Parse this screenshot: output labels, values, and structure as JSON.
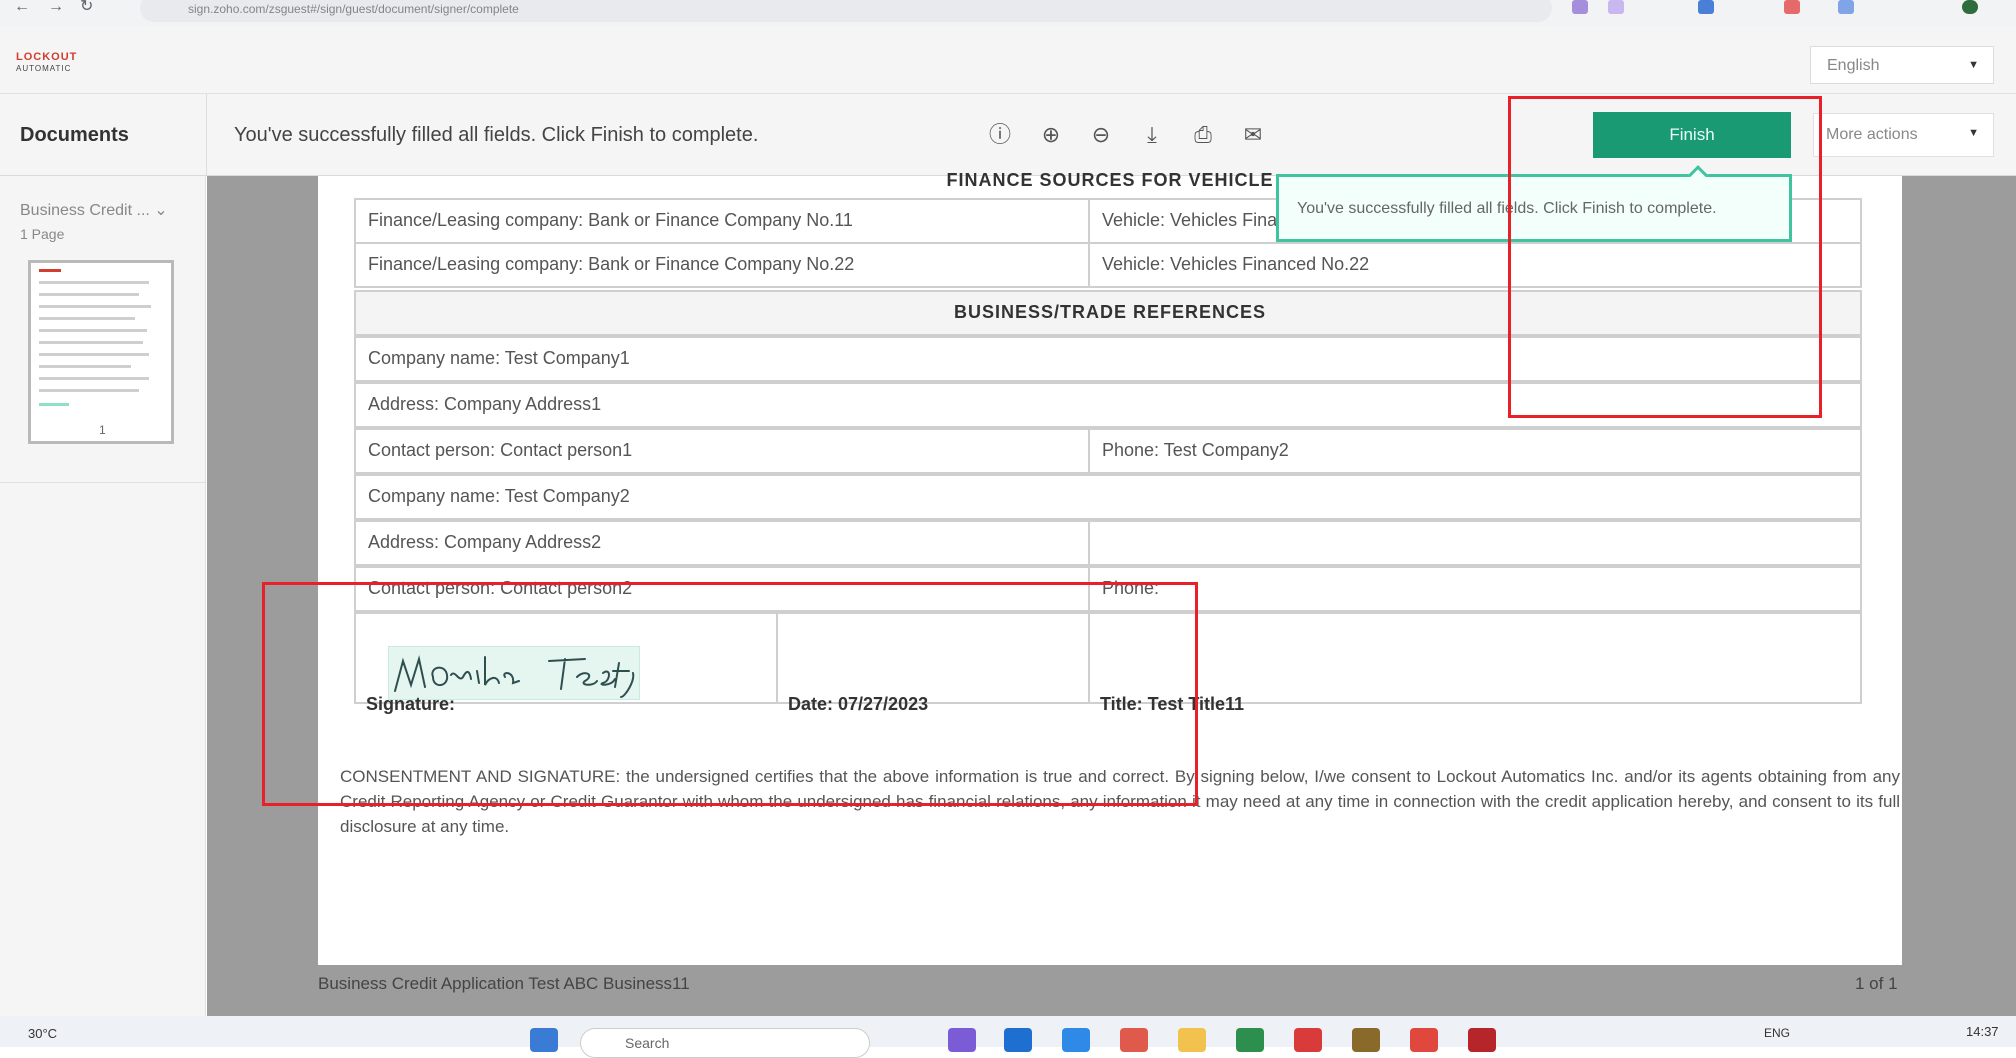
{
  "browser": {
    "url": "sign.zoho.com/zsguest#/sign/guest/document/signer/complete"
  },
  "header": {
    "logo_line1": "LOCKOUT",
    "logo_line2": "AUTOMATIC",
    "language": "English"
  },
  "toolbar": {
    "documents_label": "Documents",
    "status_message": "You've successfully filled all fields. Click Finish to complete.",
    "finish_label": "Finish",
    "more_actions_label": "More actions"
  },
  "sidebar": {
    "document_title": "Business Credit ...",
    "pages": "1 Page",
    "thumb_page_number": "1"
  },
  "tooltip": {
    "text": "You've successfully filled all fields. Click Finish to complete."
  },
  "document": {
    "section_finance": "FINANCE SOURCES FOR VEHICLE",
    "finance_rows": [
      {
        "left": "Finance/Leasing company: Bank or Finance Company No.11",
        "right": "Vehicle: Vehicles Financed No.11"
      },
      {
        "left": "Finance/Leasing company: Bank or Finance Company No.22",
        "right": "Vehicle: Vehicles Financed No.22"
      }
    ],
    "section_business": "BUSINESS/TRADE REFERENCES",
    "company1_name": "Company name: Test Company1",
    "company1_address": "Address: Company Address1",
    "company1_contact": "Contact person: Contact person1",
    "company1_phone": "Phone: Test Company2",
    "company2_name": "Company name: Test Company2",
    "company2_address": "Address: Company Address2",
    "company2_contact": "Contact person: Contact person2",
    "company2_phone": "Phone:",
    "signature_text": "MOnika Testy",
    "signature_label": "Signature:",
    "date_label": "Date: 07/27/2023",
    "title_label": "Title: Test Title11",
    "consent": "CONSENTMENT AND SIGNATURE: the undersigned certifies that the above information is true and correct. By signing below, I/we consent to Lockout Automatics Inc. and/or its agents obtaining from any Credit Reporting Agency or Credit Guarantor with whom the undersigned has financial relations, any information it may need at any time in connection with the credit application hereby, and consent to its full disclosure at any time."
  },
  "footer": {
    "left": "Business Credit Application Test ABC Business11",
    "right": "1 of 1"
  },
  "taskbar": {
    "weather": "30°C",
    "search_placeholder": "Search",
    "lang": "ENG",
    "clock": "14:37"
  },
  "colors": {
    "finish_green": "#1a9a73",
    "tooltip_border": "#41c3a0",
    "highlight_red": "#e8202a"
  }
}
